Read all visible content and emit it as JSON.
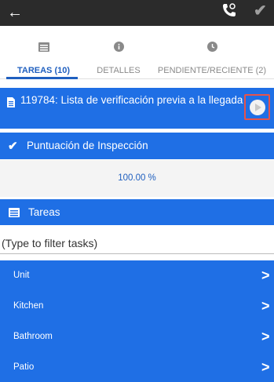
{
  "topbar": {
    "back_icon": "←",
    "check_icon": "✔"
  },
  "tabs": [
    {
      "label": "TAREAS (10)",
      "icon": "list-icon"
    },
    {
      "label": "DETALLES",
      "icon": "info-icon"
    },
    {
      "label": "PENDIENTE/RECIENTE (2)",
      "icon": "clock-icon"
    }
  ],
  "task_header": {
    "title": "119784: Lista de verificación previa a la llegada"
  },
  "score": {
    "heading": "Puntuación de Inspección",
    "value": "100.00 %",
    "check_icon": "✔"
  },
  "tasks_section": {
    "heading": "Tareas"
  },
  "filter": {
    "placeholder": "(Type to filter tasks)"
  },
  "items": [
    {
      "label": "Unit"
    },
    {
      "label": "Kitchen"
    },
    {
      "label": "Bathroom"
    },
    {
      "label": "Patio"
    }
  ],
  "arrow_glyph": ">",
  "colors": {
    "primary": "#1f6fe5",
    "tab_active": "#1f5fbf",
    "topbar": "#2b2b2b",
    "highlight": "#e8534a"
  }
}
